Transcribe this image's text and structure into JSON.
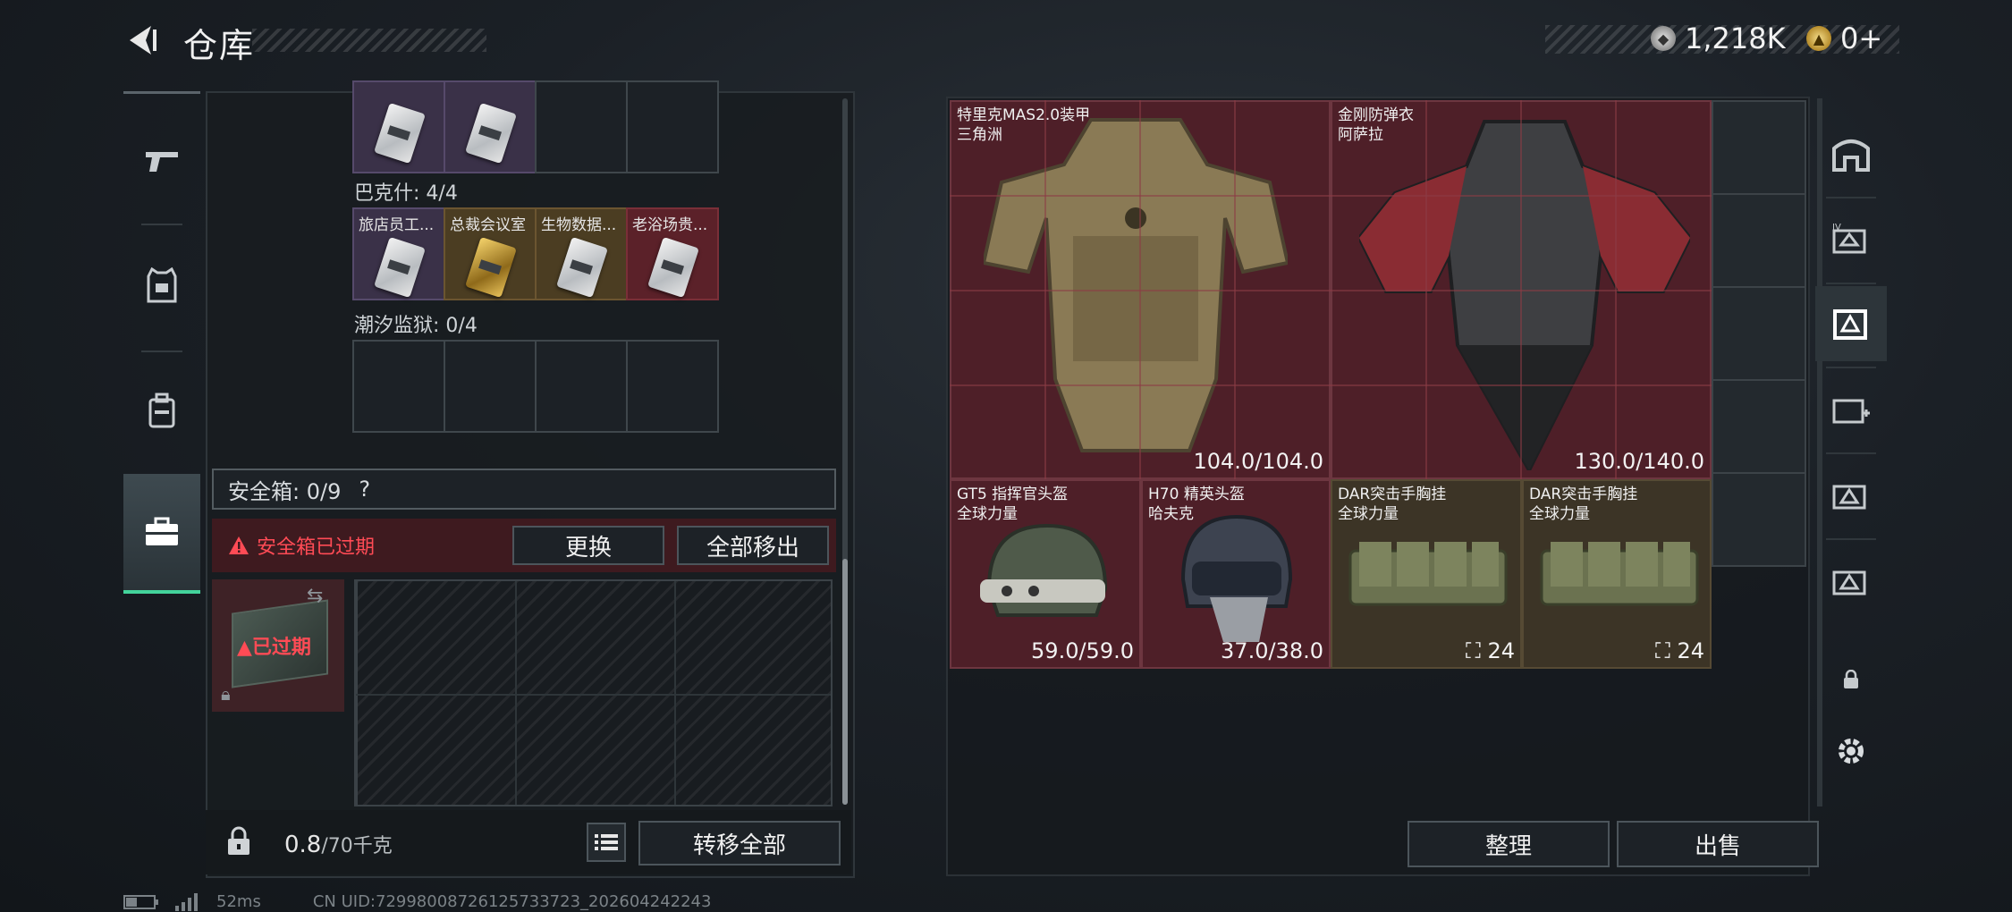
{
  "header": {
    "back_icon": "back-arrow-icon",
    "title": "仓库",
    "currency_silver": "1,218K",
    "currency_gold": "0+"
  },
  "left_nav": {
    "items": [
      {
        "name": "weapon",
        "icon": "pistol-icon"
      },
      {
        "name": "armor",
        "icon": "vest-icon"
      },
      {
        "name": "backpack",
        "icon": "backpack-icon"
      },
      {
        "name": "safebox",
        "icon": "briefcase-icon",
        "active": true
      }
    ]
  },
  "keycards": {
    "group1_cells": [
      "",
      "",
      "",
      ""
    ],
    "group2_label": "巴克什: 4/4",
    "group2_cells": [
      "旅店员工...",
      "总裁会议室",
      "生物数据...",
      "老浴场贵..."
    ],
    "group3_label": "潮汐监狱: 0/4"
  },
  "safebox": {
    "title": "安全箱: 0/9",
    "help": "?",
    "warning": "安全箱已过期",
    "replace_label": "更换",
    "move_all_label": "全部移出",
    "expired_label": "已过期"
  },
  "bottom": {
    "weight_value": "0.8",
    "weight_max": "/70千克",
    "transfer_label": "转移全部"
  },
  "stash": {
    "items": [
      {
        "name": "特里克MAS2.0装甲\n三角洲",
        "durability": "104.0/104.0"
      },
      {
        "name": "金刚防弹衣\n阿萨拉",
        "durability": "130.0/140.0"
      },
      {
        "name": "GT5 指挥官头盔\n全球力量",
        "durability": "59.0/59.0"
      },
      {
        "name": "H70 精英头盔\n哈夫克",
        "durability": "37.0/38.0"
      },
      {
        "name": "DAR突击手胸挂\n全球力量",
        "durability": "24"
      },
      {
        "name": "DAR突击手胸挂\n全球力量",
        "durability": "24"
      }
    ],
    "sort_label": "整理",
    "sell_label": "出售"
  },
  "status": {
    "ping": "52ms",
    "uid": "CN UID:72998008726125733723_202604242243"
  }
}
